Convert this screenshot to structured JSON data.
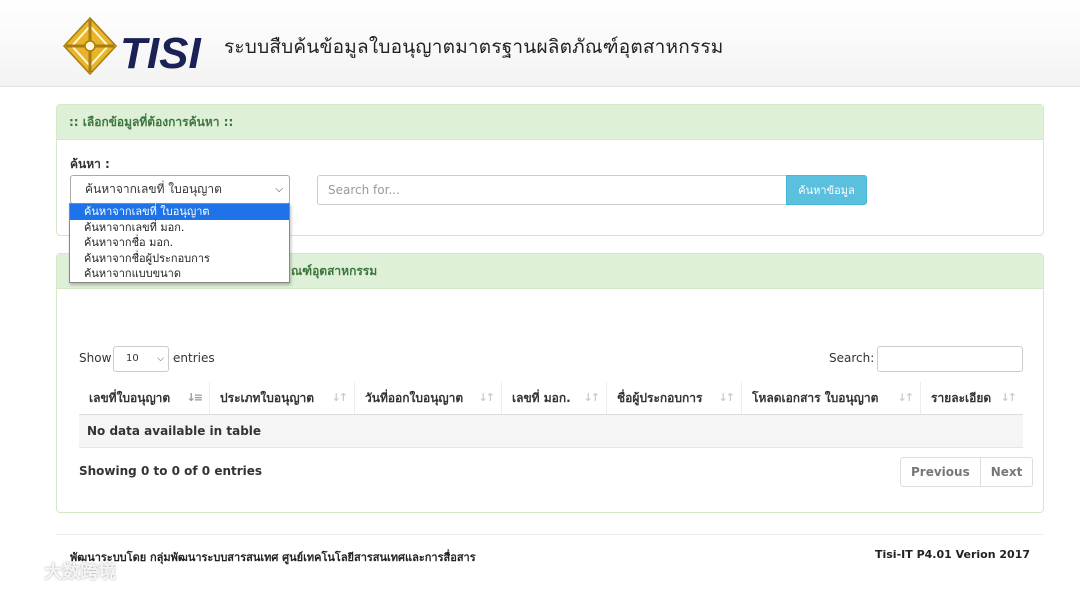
{
  "header": {
    "logo_text": "TISI",
    "site_title": "ระบบสืบค้นข้อมูลใบอนุญาตมาตรฐานผลิตภัณฑ์อุตสาหกรรม"
  },
  "search_panel": {
    "heading": ":: เลือกข้อมูลที่ต้องการค้นหา ::",
    "label": "ค้นหา :",
    "selected_option": "ค้นหาจากเลขที่ ใบอนุญาต",
    "options": [
      "ค้นหาจากเลขที่ ใบอนุญาต",
      "ค้นหาจากเลขที่ มอก.",
      "ค้นหาจากชื่อ มอก.",
      "ค้นหาจากชื่อผู้ประกอบการ",
      "ค้นหาจากแบบขนาด"
    ],
    "search_placeholder": "Search for...",
    "search_value": "",
    "search_button": "ค้นหาข้อมูล"
  },
  "results_panel": {
    "heading_visible_part": "ณฑ์อุตสาหกรรม",
    "show_label": "Show",
    "entries_value": "10",
    "entries_label": "entries",
    "filter_label": "Search:",
    "filter_value": "",
    "columns": [
      "เลขที่ใบอนุญาต",
      "ประเภทใบอนุญาต",
      "วันที่ออกใบอนุญาต",
      "เลขที่ มอก.",
      "ชื่อผู้ประกอบการ",
      "โหลดเอกสาร ใบอนุญาต",
      "รายละเอียด"
    ],
    "empty_message": "No data available in table",
    "info": "Showing 0 to 0 of 0 entries",
    "prev_button": "Previous",
    "next_button": "Next"
  },
  "footer": {
    "left": "พัฒนาระบบโดย กลุ่มพัฒนาระบบสารสนเทศ ศูนย์เทคโนโลยีสารสนเทศและการสื่อสาร",
    "right": "Tisi-IT P4.01 Verion 2017"
  },
  "watermark": "大数跨境",
  "colors": {
    "panel_heading_bg": "#dff0d8",
    "panel_heading_text": "#3c763d",
    "search_button_bg": "#5bc0de",
    "dropdown_selected_bg": "#1e73e8",
    "logo_gold": "#e8b52a",
    "logo_navy": "#1a2255"
  }
}
